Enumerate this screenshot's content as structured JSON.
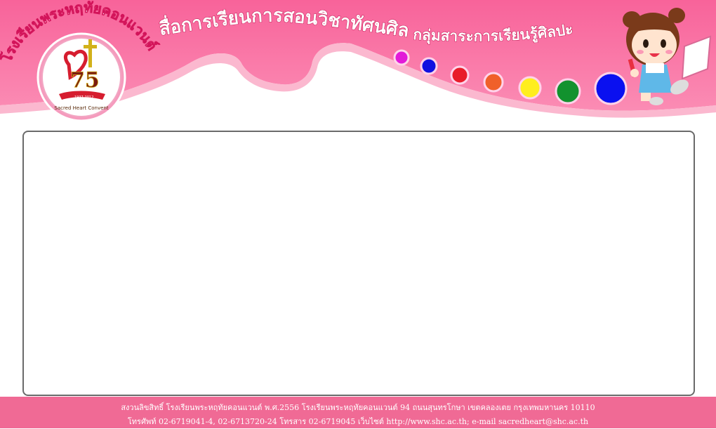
{
  "header": {
    "school_name": "โรงเรียนพระหฤทัยคอนแวนต์",
    "title": "สื่อการเรียนการสอนวิชาทัศนศิลป์",
    "subtitle": "กลุ่มสาระการเรียนรู้ศิลปะ",
    "logo": {
      "anniversary": "75",
      "years": "1937-2012",
      "caption": "Sacred Heart Convent"
    },
    "paint_dots": [
      {
        "color": "#e21bd8",
        "icon": "paint-dot-magenta"
      },
      {
        "color": "#1010e0",
        "icon": "paint-dot-blue"
      },
      {
        "color": "#e81c2a",
        "icon": "paint-dot-red"
      },
      {
        "color": "#f0602a",
        "icon": "paint-dot-orange"
      },
      {
        "color": "#ffee1e",
        "icon": "paint-dot-yellow"
      },
      {
        "color": "#12922e",
        "icon": "paint-dot-green"
      },
      {
        "color": "#0a10f0",
        "icon": "paint-dot-blue-large"
      }
    ],
    "mascot": "girl-with-pencil-and-paper"
  },
  "colors": {
    "banner_pink": "#f5709c",
    "banner_light": "#fbb8cf",
    "footer_pink": "#f06a95",
    "frame_border": "#6a6a6a"
  },
  "footer": {
    "copyright": "สงวนลิขสิทธิ์ โรงเรียนพระหฤทัยคอนแวนต์ พ.ศ.2556  โรงเรียนพระหฤทัยคอนแวนต์ 94 ถนนสุนทรโกษา เขตคลองเตย กรุงเทพมหานคร 10110",
    "contact_prefix": "โทรศัพท์ 02-6719041-4, 02-6713720-24 โทรสาร 02-6719045 เว็บไซต์ ",
    "website": "http://www.shc.ac.th",
    "email_prefix": "; e-mail ",
    "email": "sacredheart@shc.ac.th"
  }
}
